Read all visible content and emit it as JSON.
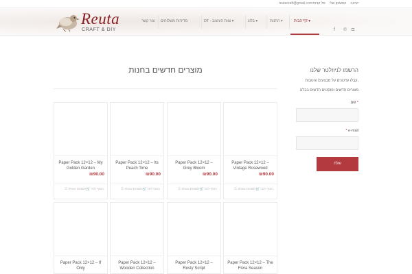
{
  "topbar": {
    "links": [
      "יציאה",
      "החשבון שלי",
      "סל קניות"
    ],
    "email": "reutacraft@gmail.com"
  },
  "logo": {
    "brand": "Reuta",
    "tagline": "CRAFT & DIY"
  },
  "nav": {
    "items": [
      {
        "label": "דף הבית ▾"
      },
      {
        "label": "החנות ▾"
      },
      {
        "label": "בלוג ▾"
      },
      {
        "label": "DT - צוות העיצוב ▾"
      },
      {
        "label": "מדיניות משלוחים"
      },
      {
        "label": "צור קשר"
      }
    ]
  },
  "social": {
    "icons": [
      "instagram-icon",
      "pinterest-icon",
      "facebook-icon"
    ],
    "glyphs": [
      "◘",
      "℗",
      "f"
    ]
  },
  "main": {
    "title": "מוצרים חדשים בחנות",
    "products": [
      {
        "name": "Paper Pack 12×12 – Vintage Rosewood",
        "price": "₪90.00",
        "cart_label": "הוסף לסל",
        "details_label": "Show Details"
      },
      {
        "name": "Paper Pack 12×12 – Grey Bloom",
        "price": "₪90.00",
        "cart_label": "הוסף לסל",
        "details_label": "Show Details"
      },
      {
        "name": "Paper Pack 12×12 – Its Peach Time",
        "price": "₪90.00",
        "cart_label": "הוסף לסל",
        "details_label": "Show Details"
      },
      {
        "name": "Paper Pack 12×12 – My Golden Garden",
        "price": "₪90.00",
        "cart_label": "הוסף לסל",
        "details_label": "Show Details"
      },
      {
        "name": "Paper Pack 12×12 – The Flora Season",
        "price": "",
        "cart_label": "",
        "details_label": ""
      },
      {
        "name": "Paper Pack 12×12 – Rusty Script",
        "price": "",
        "cart_label": "",
        "details_label": ""
      },
      {
        "name": "Paper Pack 12×12 – Wooden Collection",
        "price": "",
        "cart_label": "",
        "details_label": ""
      },
      {
        "name": "Paper Pack 12×12 – If Only",
        "price": "",
        "cart_label": "",
        "details_label": ""
      }
    ]
  },
  "sidebar": {
    "title": "הרשמו לניוזלטר שלנו",
    "line1": "קבלו עדכונים על מבצעים והטבות,",
    "line2": "מוצרים חדשים ופוסטים חדשים בבלוג",
    "name_label": "שם",
    "email_label": "e-mail",
    "required_mark": "*",
    "submit_label": "שלח"
  },
  "colors": {
    "accent": "#b33a3f",
    "brand": "#8a1e23"
  }
}
